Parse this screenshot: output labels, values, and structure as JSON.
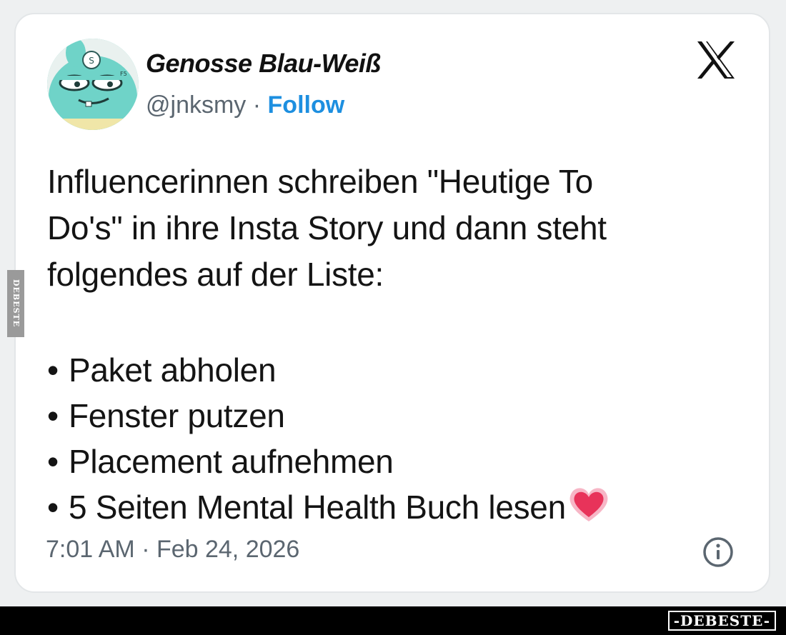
{
  "author": {
    "display_name": "Genosse Blau-Weiß",
    "handle": "@jnksmy",
    "separator": " · ",
    "follow_label": "Follow",
    "avatar_icon": "cartoon-cat-avatar"
  },
  "platform_icon": "x-logo-icon",
  "tweet": {
    "text_lines": [
      "Influencerinnen schreiben \"Heutige To",
      "Do's\" in ihre Insta Story und dann steht",
      "folgendes auf der Liste:"
    ],
    "bullet": "•",
    "list_items": [
      "Paket abholen",
      "Fenster putzen",
      "Placement aufnehmen",
      "5 Seiten Mental Health Buch lesen"
    ],
    "emoji": "heart-emoji"
  },
  "timestamp": "7:01 AM · Feb 24, 2026",
  "info_icon": "info-icon",
  "watermarks": {
    "side": "DEBESTE",
    "bottom": "-DEBESTE-"
  },
  "colors": {
    "follow": "#1d8fe0",
    "text": "#141414",
    "muted": "#5b6670",
    "heart": "#e8335a"
  }
}
